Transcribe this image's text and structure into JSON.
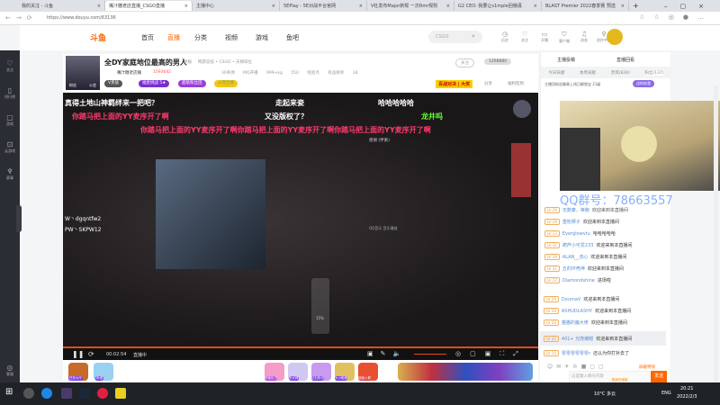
{
  "browser": {
    "tabs": [
      {
        "title": "我的关注 - 斗鱼"
      },
      {
        "title": "嘴汁糖老店直播_CSGO直播"
      },
      {
        "title": "主播中心"
      },
      {
        "title": "5EPlay - 5E对战平台官网"
      },
      {
        "title": "V社发布Major新规 一次Rmr规则"
      },
      {
        "title": "G2 CEO: 我要让s1mple回俄语"
      },
      {
        "title": "BLAST Premier 2022春季赛 预选"
      }
    ],
    "url": "https://www.douyu.com/63136"
  },
  "site": {
    "logo": "斗鱼",
    "nav": [
      "首页",
      "直播",
      "分类",
      "视频",
      "游戏",
      "鱼吧"
    ],
    "search_placeholder": "CSGO",
    "icons": [
      {
        "name": "history",
        "label": "历史"
      },
      {
        "name": "follow",
        "label": "关注"
      },
      {
        "name": "broadcast",
        "label": "开播"
      },
      {
        "name": "shop",
        "label": "客户端"
      },
      {
        "name": "message",
        "label": "消息"
      },
      {
        "name": "creator",
        "label": "创作中心"
      }
    ]
  },
  "sidebar": [
    {
      "label": "关注"
    },
    {
      "label": "排行榜"
    },
    {
      "label": "游戏"
    },
    {
      "label": "云游戏"
    },
    {
      "label": "赛事"
    },
    {
      "label": "客服"
    }
  ],
  "room": {
    "title": "全DY家庭地位最高的男人",
    "tag": "举报",
    "category": "网游竞技 • CSGO • 天梯排位",
    "anchor": "嘴汁糖老店播",
    "hot": "1093642",
    "stats": [
      "30条弹",
      "MQ开播",
      "999+kg",
      "550 经验点",
      "有品榜单 18"
    ],
    "follow_label": "关注",
    "fans": "1298880",
    "badges": [
      "V贵族",
      "福星挑战 5★",
      "超级粉丝团",
      "从而至播"
    ],
    "promo": "百战对决 | 大奖",
    "share": "分享",
    "report": "福利签到",
    "avatar_labels": [
      "粉丝",
      "公会"
    ]
  },
  "video": {
    "danmaku": [
      {
        "text": "真得土地山神羁绊来一把吧？",
        "color": "#ffffff"
      },
      {
        "text": "走起来瓷",
        "color": "#ffffff"
      },
      {
        "text": "哈哈哈哈哈",
        "color": "#ffffff"
      },
      {
        "text": "你踏马把上面的YY麦序开了啊",
        "color": "#ff3b6b"
      },
      {
        "text": "又没版权了？",
        "color": "#ffffff"
      },
      {
        "text": "龙井吗",
        "color": "#66ff33"
      },
      {
        "text": "你踏马把上面的YY麦序开了啊你踏马把上面的YY麦序开了啊你踏马把上面的YY麦序开了啊",
        "color": "#ff3b6b"
      }
    ],
    "song": "感谢 (伴奏)",
    "overlay_names": [
      "W丶dgqntfw2",
      "PW丶SKPW12"
    ],
    "qq_label": "QQ音乐 音乐播放",
    "volume": "15%",
    "time": "00:02:54",
    "status": "直播中"
  },
  "gifts": {
    "left": [
      "任务大厅",
      "奇遇"
    ],
    "right": [
      "超值告白",
      "荧光棒",
      "钻石粉丝",
      "大小鲍鱼",
      "超级火箭"
    ]
  },
  "chat": {
    "tabs": [
      "主播投稿",
      "直播回看"
    ],
    "rank_tabs": [
      "今日贡献",
      "本周贡献",
      "贵宾(828)",
      "粉丝(137)"
    ],
    "notice": "主播用粉丝徽章上线日解锁宝 21级",
    "notice_button": "送的给我",
    "watermark": "QQ群号：78663557",
    "messages": [
      {
        "lv": "LV 29",
        "user": "无数秦，等散",
        "text": "欢迎来到本直播间"
      },
      {
        "lv": "LV 29",
        "user": "重粉狮子",
        "text": "欢迎来到本直播间"
      },
      {
        "lv": "LV 13",
        "user": "Everglowvtu",
        "text": "哈哈哈哈哈"
      },
      {
        "lv": "LV 31",
        "user": "葫芦小可爱233",
        "text": "欢迎来到本直播间"
      },
      {
        "lv": "LV 29",
        "user": "ALAN__流心",
        "text": "欢迎来到本直播间"
      },
      {
        "lv": "LV 31",
        "user": "五的环壳神",
        "text": "欢迎来到本直播间"
      },
      {
        "lv": "LV 37",
        "user": "Diamondshine",
        "text": "进场啦"
      },
      {
        "lv": "LV 29",
        "user": "DoumaV",
        "text": "欢迎来到本直播间"
      },
      {
        "lv": "LV 29",
        "user": "ASHUDLASHY",
        "text": "欢迎来到本直播间"
      },
      {
        "lv": "LV 26",
        "user": "猫猫的魔大佬",
        "text": "欢迎来到本直播间"
      },
      {
        "lv": "LV 42",
        "user": "401+ 光既耀眼",
        "text": "欢迎来到本直播间"
      },
      {
        "lv": "LV 10",
        "user": "零零零零零零r",
        "text": "还以为你打补去了"
      }
    ],
    "block_label": "屏蔽特效",
    "input_placeholder": "这里输入聊天内容",
    "send": "发送",
    "hint": "戳我的弹幕"
  },
  "taskbar": {
    "weather": "10°C 多云",
    "lang": "ENG",
    "time": "20:21",
    "date": "2022/2/3"
  }
}
